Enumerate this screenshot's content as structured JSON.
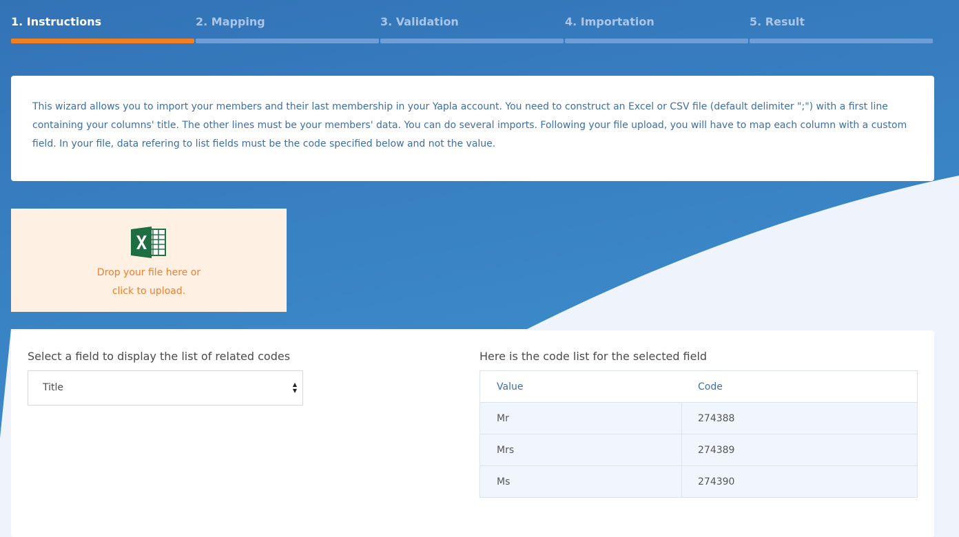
{
  "steps": [
    {
      "label": "1. Instructions",
      "active": true
    },
    {
      "label": "2. Mapping",
      "active": false
    },
    {
      "label": "3. Validation",
      "active": false
    },
    {
      "label": "4. Importation",
      "active": false
    },
    {
      "label": "5. Result",
      "active": false
    }
  ],
  "instructions": {
    "text": "This wizard allows you to import your members and their last membership in your Yapla account. You need to construct an Excel or CSV file (default delimiter \";\") with a first line containing your columns' title. The other lines must be your members' data. You can do several imports. Following your file upload, you will have to map each column with a custom field. In your file, data refering to list fields must be the code specified below and not the value."
  },
  "upload": {
    "icon": "excel-icon",
    "line1": "Drop your file here or",
    "line2": "click to upload."
  },
  "codes": {
    "select_label": "Select a field to display the list of related codes",
    "selected_field": "Title",
    "list_label": "Here is the code list for the selected field",
    "columns": [
      "Value",
      "Code"
    ],
    "rows": [
      {
        "value": "Mr",
        "code": "274388"
      },
      {
        "value": "Mrs",
        "code": "274389"
      },
      {
        "value": "Ms",
        "code": "274390"
      }
    ]
  },
  "colors": {
    "background_blue": "#3a7fc2",
    "accent_orange": "#f47f20",
    "text_blue": "#3c6fa7",
    "dropzone_bg": "#fff0e4"
  }
}
